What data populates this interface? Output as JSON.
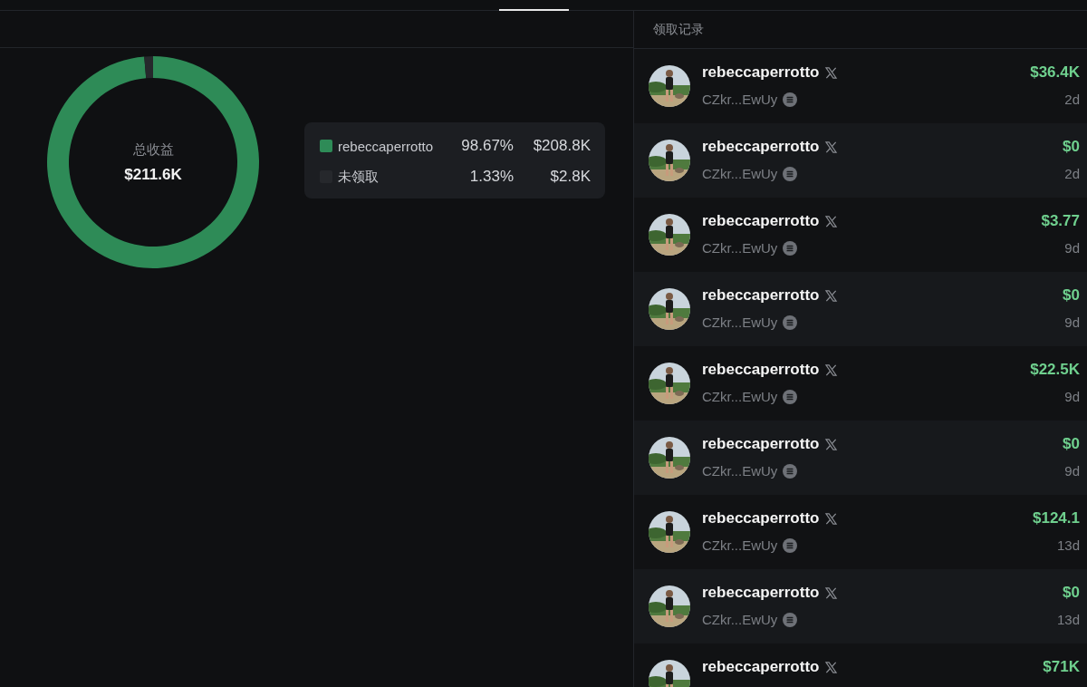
{
  "summary": {
    "label": "总收益",
    "total": "$211.6K",
    "chart_data": {
      "type": "donut",
      "categories": [
        "rebeccaperrotto",
        "未领取"
      ],
      "series": [
        {
          "values": [
            98.67,
            1.33
          ]
        }
      ]
    }
  },
  "legend": [
    {
      "color": "#2e8b57",
      "percent": "98.67%",
      "amount": "$208.8K"
    },
    {
      "color": "#26282c",
      "percent": "1.33%",
      "amount": "$2.8K"
    }
  ],
  "claims": {
    "title": "领取记录",
    "rows": [
      {
        "name": "rebeccaperrotto",
        "address": "CZkr...EwUy",
        "amount": "$36.4K",
        "time": "2d"
      },
      {
        "name": "rebeccaperrotto",
        "address": "CZkr...EwUy",
        "amount": "$0",
        "time": "2d"
      },
      {
        "name": "rebeccaperrotto",
        "address": "CZkr...EwUy",
        "amount": "$3.77",
        "time": "9d"
      },
      {
        "name": "rebeccaperrotto",
        "address": "CZkr...EwUy",
        "amount": "$0",
        "time": "9d"
      },
      {
        "name": "rebeccaperrotto",
        "address": "CZkr...EwUy",
        "amount": "$22.5K",
        "time": "9d"
      },
      {
        "name": "rebeccaperrotto",
        "address": "CZkr...EwUy",
        "amount": "$0",
        "time": "9d"
      },
      {
        "name": "rebeccaperrotto",
        "address": "CZkr...EwUy",
        "amount": "$124.1",
        "time": "13d"
      },
      {
        "name": "rebeccaperrotto",
        "address": "CZkr...EwUy",
        "amount": "$0",
        "time": "13d"
      },
      {
        "name": "rebeccaperrotto",
        "amount": "$71K"
      }
    ]
  }
}
